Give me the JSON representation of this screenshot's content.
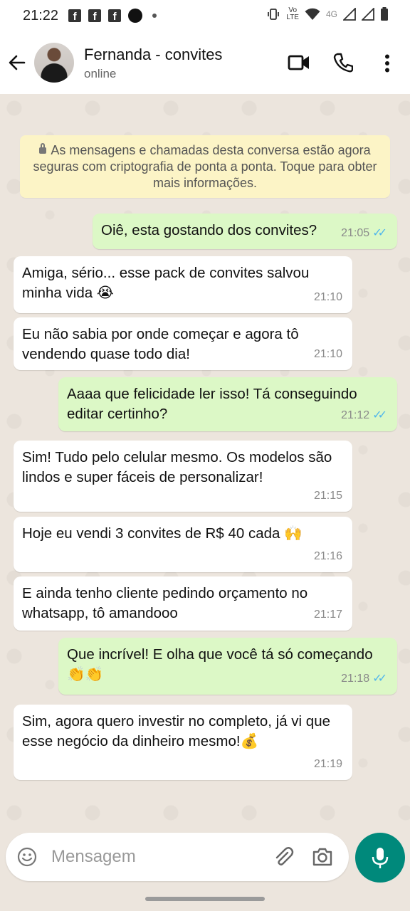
{
  "statusbar": {
    "time": "21:22",
    "volte_top": "Vo",
    "volte_bottom": "LTE",
    "network_label": "4G",
    "icons": [
      "facebook-icon",
      "facebook-icon",
      "facebook-icon",
      "notification-dot-icon",
      "small-dot-icon",
      "vibrate-icon",
      "wifi-icon",
      "signal-icon",
      "signal-icon",
      "battery-icon"
    ]
  },
  "header": {
    "contact_name": "Fernanda - convites",
    "status": "online",
    "icons": [
      "back-arrow-icon",
      "video-call-icon",
      "phone-icon",
      "more-vert-icon"
    ]
  },
  "encryption_notice": "As mensagens e chamadas desta conversa estão agora seguras com criptografia de ponta a ponta. Toque para obter mais informações.",
  "messages": [
    {
      "direction": "out",
      "text": "Oiê, esta gostando dos convites?",
      "time": "21:05",
      "read": true
    },
    {
      "direction": "in",
      "text": "Amiga, sério... esse pack de convites salvou minha vida 😭",
      "time": "21:10"
    },
    {
      "direction": "in",
      "text": "Eu não sabia por onde começar e agora tô vendendo quase todo dia!",
      "time": "21:10"
    },
    {
      "direction": "out",
      "text": "Aaaa que felicidade ler isso! Tá conseguindo editar certinho?",
      "time": "21:12",
      "read": true
    },
    {
      "direction": "in",
      "text": "Sim! Tudo pelo celular mesmo. Os modelos são lindos e super fáceis de personalizar!",
      "time": "21:15"
    },
    {
      "direction": "in",
      "text": "Hoje eu vendi 3 convites de R$ 40 cada 🙌",
      "time": "21:16"
    },
    {
      "direction": "in",
      "text": "E ainda tenho cliente pedindo orçamento no whatsapp, tô amandooo",
      "time": "21:17"
    },
    {
      "direction": "out",
      "text": "Que incrível! E olha que você tá só começando 👏👏",
      "time": "21:18",
      "read": true
    },
    {
      "direction": "in",
      "text": "Sim, agora quero investir no completo, já vi que esse negócio da dinheiro mesmo!💰",
      "time": "21:19"
    }
  ],
  "composer": {
    "placeholder": "Mensagem",
    "icons": [
      "emoji-icon",
      "attach-icon",
      "camera-icon",
      "mic-icon"
    ]
  },
  "colors": {
    "outgoing_bubble": "#dcf8c6",
    "incoming_bubble": "#ffffff",
    "chat_background": "#ece5dd",
    "notice_background": "#fcf4c6",
    "mic_button": "#00897b",
    "read_ticks": "#4fb6ec"
  }
}
